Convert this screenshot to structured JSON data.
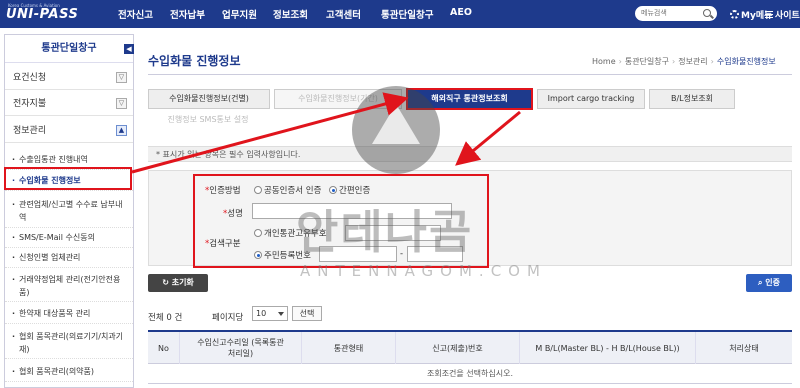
{
  "logo": {
    "sub": "Korea Customs & Aviation",
    "name": "UNI-PASS"
  },
  "nav": [
    "전자신고",
    "전자납부",
    "업무지원",
    "정보조회",
    "고객센터",
    "통관단일창구",
    "AEO"
  ],
  "search": {
    "placeholder": "메뉴검색"
  },
  "user_menu": {
    "my": "My메뉴",
    "site": "사이트"
  },
  "sidebar": {
    "title": "통관단일창구",
    "collapse": "◀",
    "items": [
      {
        "label": "요건신청",
        "toggle": "▽"
      },
      {
        "label": "전자지불",
        "toggle": "▽"
      },
      {
        "label": "정보관리",
        "toggle": "▲"
      }
    ],
    "sub_items": [
      "수출입통관 진행내역",
      "수입화물 진행정보",
      "관련업체/신고별 수수료 납부내역",
      "SMS/E-Mail 수신동의",
      "신청인별 업체관리",
      "거래약정업체 관리(전기안전용품)",
      "한약재 대상품목 관리",
      "협회 품목관리(의료기기/치과기재)",
      "협회 품목관리(의약품)"
    ]
  },
  "page": {
    "title": "수입화물 진행정보",
    "breadcrumb": [
      "Home",
      "통관단일창구",
      "정보관리",
      "수입화물진행정보"
    ]
  },
  "tabs": [
    "수입화물진행정보(건별)",
    "수입화물진행정보(기간)",
    "해외직구 통관정보조회",
    "Import cargo tracking",
    "B/L정보조회",
    "진행정보 SMS통보 설정"
  ],
  "notice": "* 표시가 있는 항목은 필수 입력사항입니다.",
  "form": {
    "auth_label": "인증방법",
    "auth_options": [
      "공동인증서 인증",
      "간편인증"
    ],
    "name_label": "성명",
    "type_label": "검색구분",
    "type_options": [
      "개인통관고유부호",
      "주민등록번호"
    ],
    "dash": "-"
  },
  "buttons": {
    "reset": "초기화",
    "search": "인증"
  },
  "list": {
    "total": "전체 0 건",
    "per_page_label": "페이지당",
    "per_page_value": "10",
    "select_btn": "선택",
    "columns": [
      "No",
      "수입신고수리일 (목록통관처리일)",
      "통관형태",
      "신고(제출)번호",
      "M B/L(Master BL) - H B/L(House BL))",
      "처리상태"
    ],
    "empty": "조회조건을 선택하십시오."
  },
  "watermark": {
    "text": "안테나곰",
    "sub": "ANTENNAGOM.COM"
  }
}
